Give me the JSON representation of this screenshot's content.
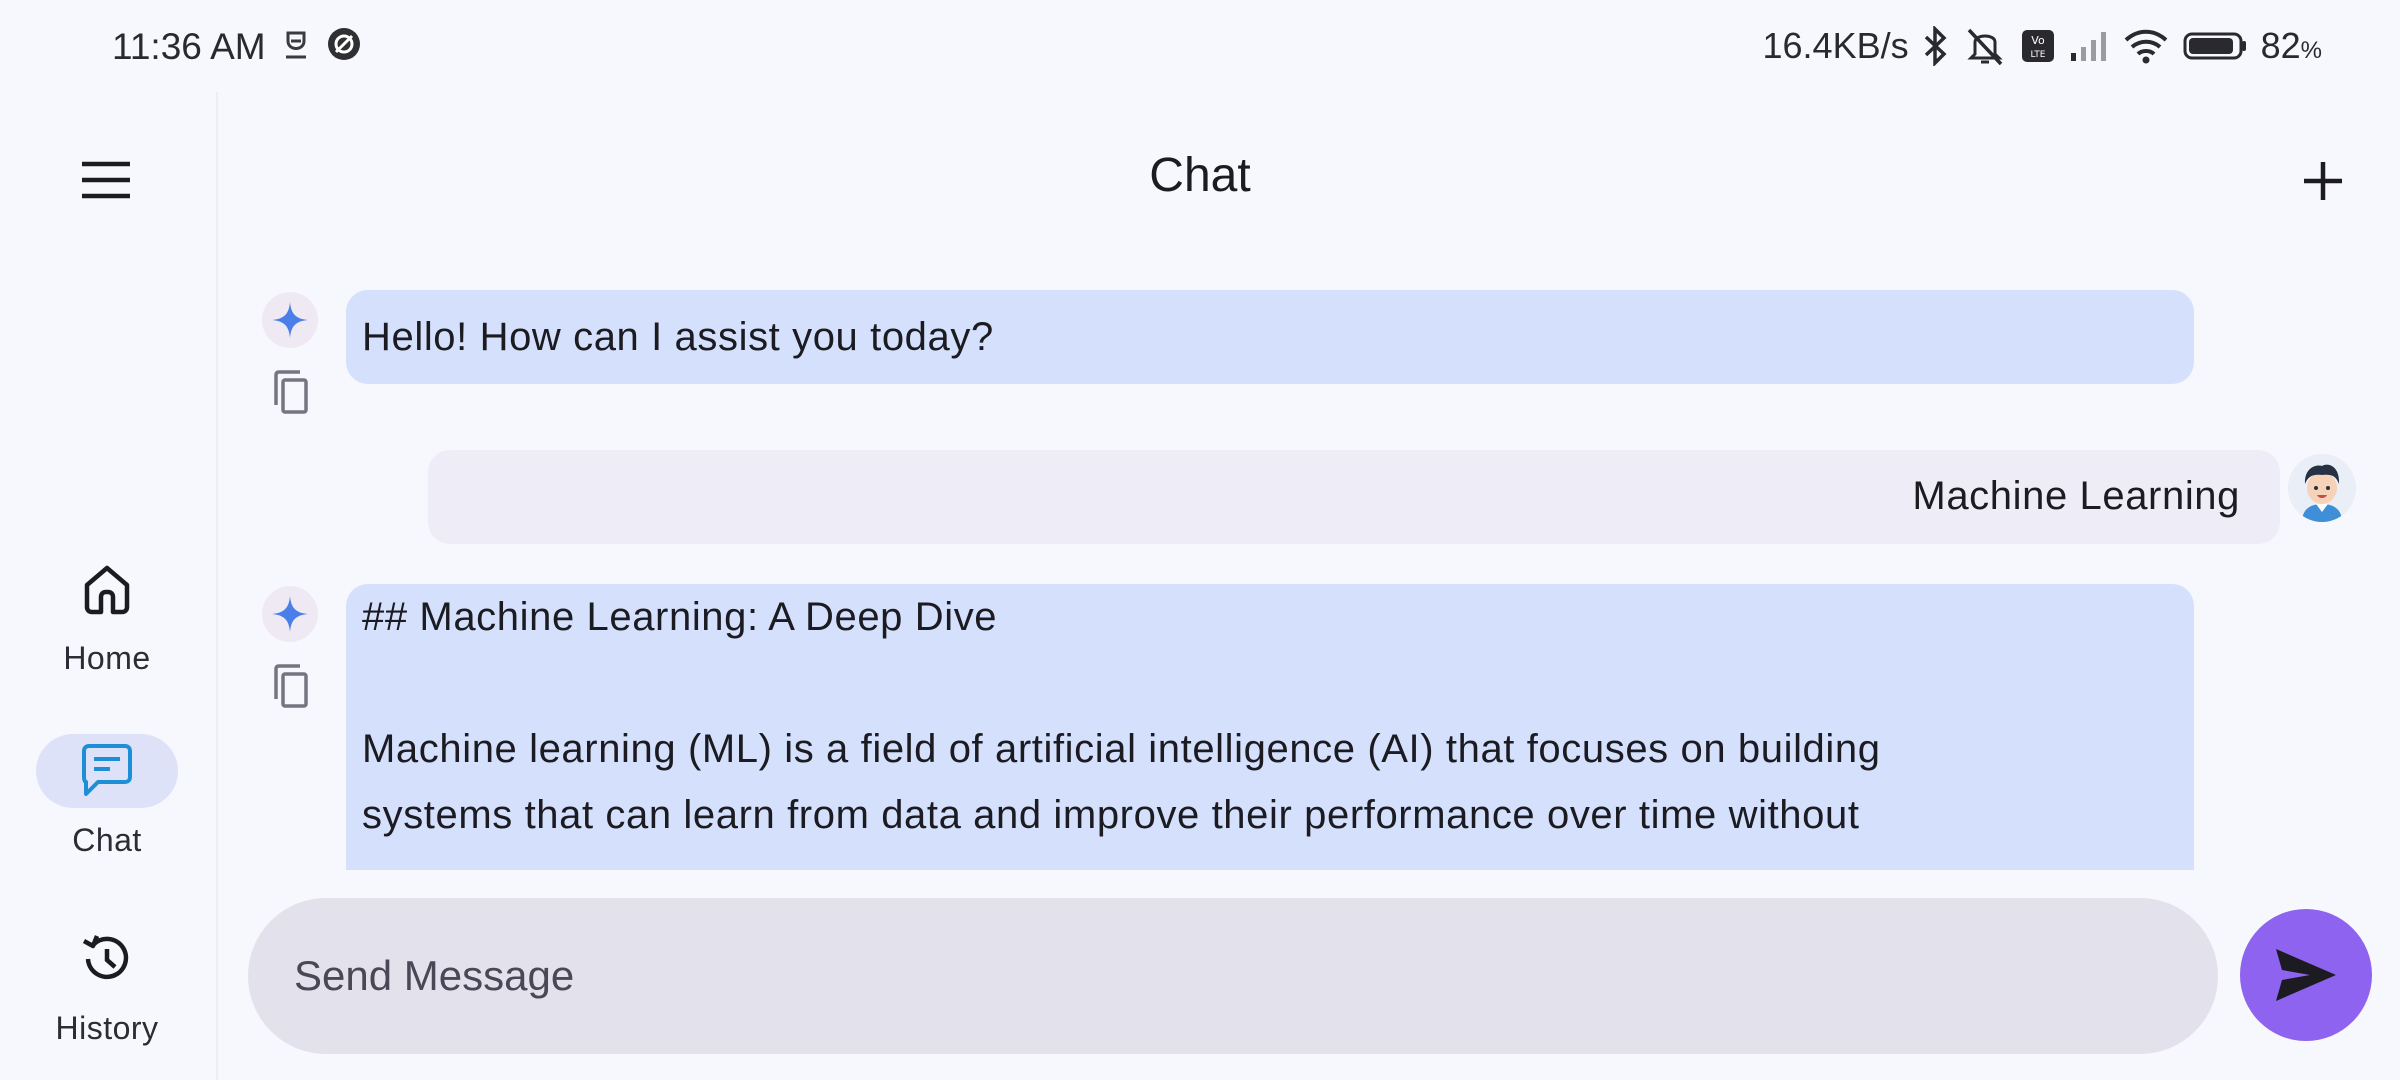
{
  "status_bar": {
    "time": "11:36 AM",
    "network_speed": "16.4KB/s",
    "battery": "82",
    "battery_unit": "%",
    "icons": [
      "notification-icon",
      "vpn-icon",
      "bluetooth-icon",
      "mute-icon",
      "volte-icon",
      "signal-icon",
      "wifi-icon",
      "battery-icon"
    ]
  },
  "nav": {
    "menu_icon": "hamburger-menu-icon",
    "items": [
      {
        "label": "Home",
        "icon": "home-icon",
        "active": false
      },
      {
        "label": "Chat",
        "icon": "chat-icon",
        "active": true
      },
      {
        "label": "History",
        "icon": "history-icon",
        "active": false
      }
    ]
  },
  "header": {
    "title": "Chat",
    "new_chat_icon": "plus-icon"
  },
  "messages": [
    {
      "role": "bot",
      "text": "Hello! How can I assist you today?"
    },
    {
      "role": "user",
      "text": "Machine Learning"
    },
    {
      "role": "bot",
      "lines": [
        "## Machine Learning: A Deep Dive",
        "",
        "Machine learning (ML) is a field of artificial intelligence (AI) that focuses on building",
        "systems that can learn from data and improve their performance over time without"
      ]
    }
  ],
  "composer": {
    "placeholder": "Send Message",
    "value": "",
    "send_icon": "send-icon"
  },
  "colors": {
    "bot_bubble": "#d4e0fc",
    "user_bubble": "#eeedf7",
    "active_nav": "#dde2f8",
    "send_button": "#8e63ef",
    "input_bg": "#e3e1ec",
    "chat_icon_accent": "#1e8fd6"
  }
}
